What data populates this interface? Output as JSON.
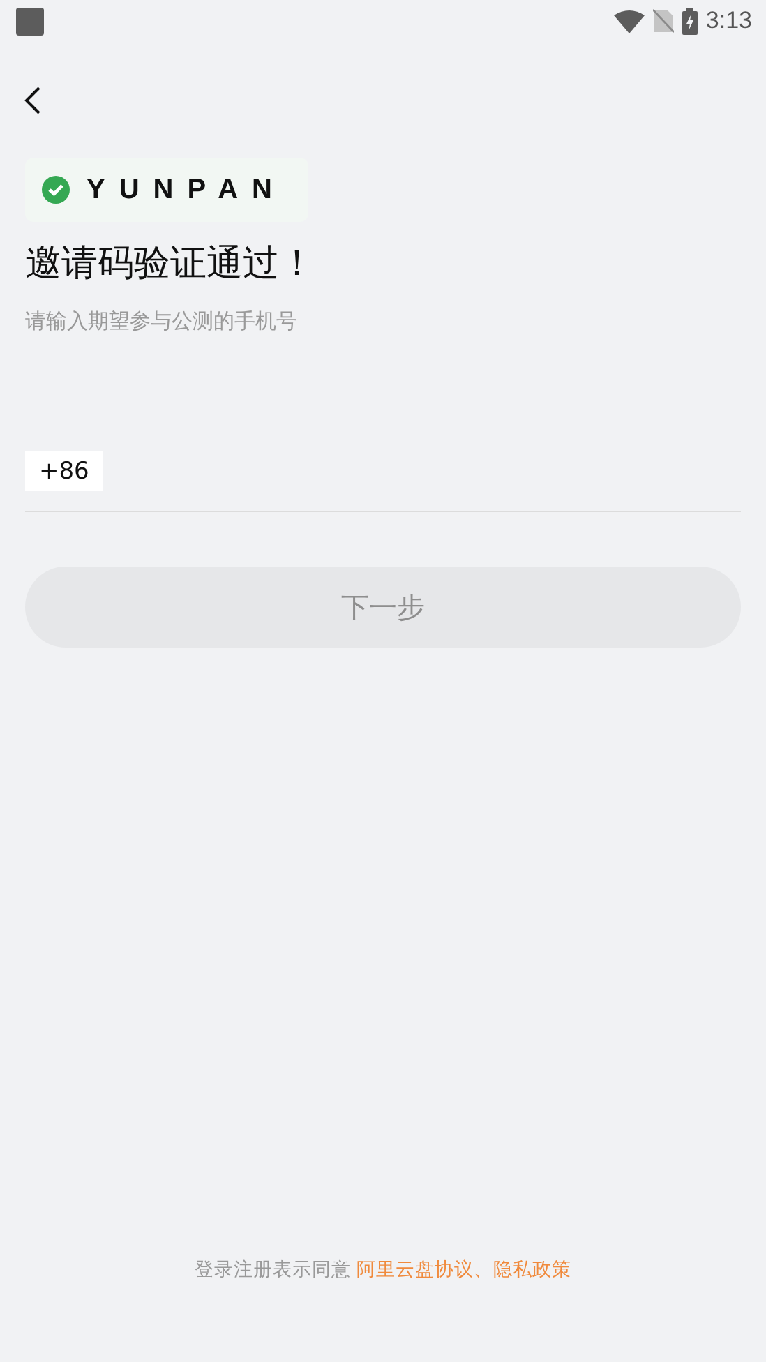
{
  "status_bar": {
    "time": "3:13"
  },
  "brand": {
    "name": "YUNPAN"
  },
  "title": "邀请码验证通过！",
  "subtitle": "请输入期望参与公测的手机号",
  "phone": {
    "country_code": "+86"
  },
  "next_button": {
    "label": "下一步",
    "disabled": true
  },
  "footer": {
    "text": "登录注册表示同意",
    "link": "阿里云盘协议、隐私政策"
  }
}
